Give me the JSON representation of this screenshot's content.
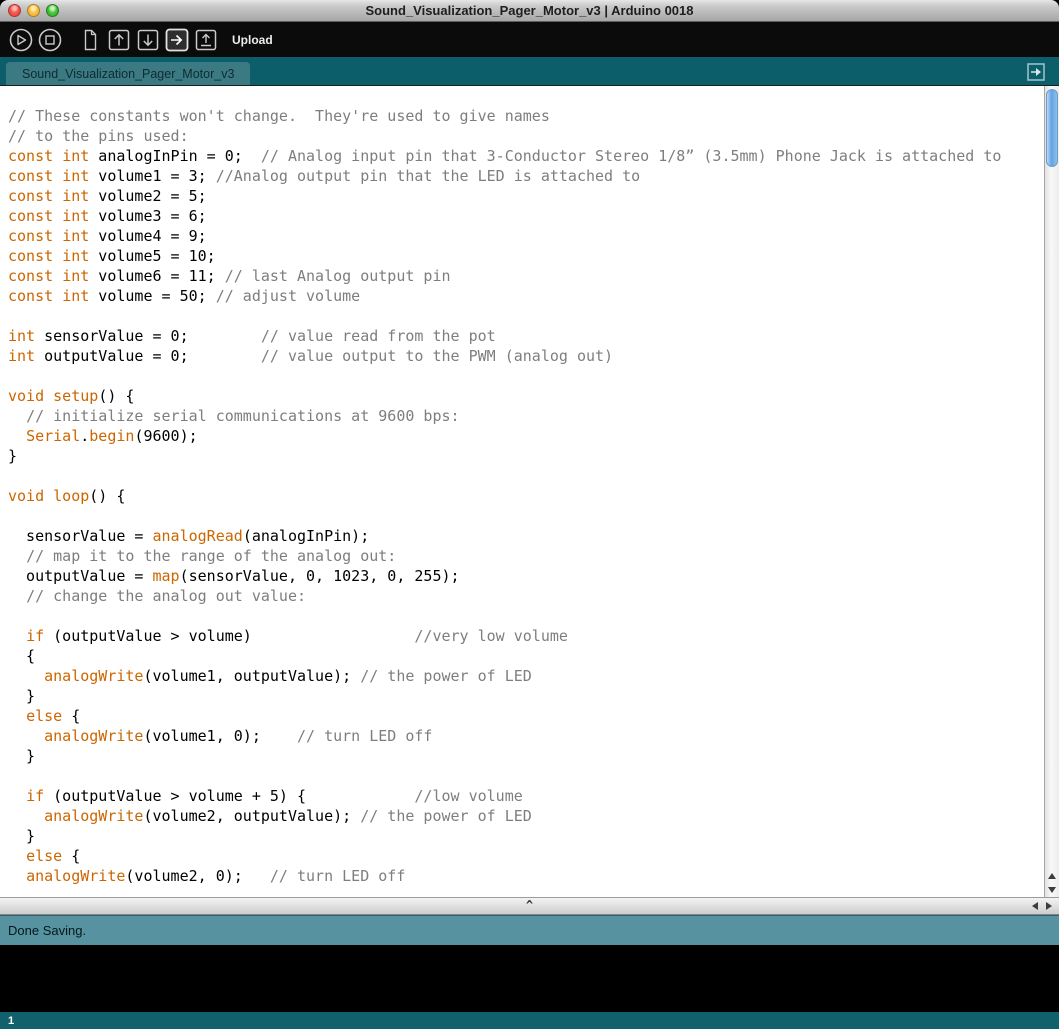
{
  "window": {
    "title": "Sound_Visualization_Pager_Motor_v3 | Arduino 0018"
  },
  "toolbar": {
    "action_label": "Upload",
    "buttons": [
      {
        "name": "verify",
        "icon": "play-circle-icon"
      },
      {
        "name": "stop",
        "icon": "stop-circle-icon"
      },
      {
        "name": "new-sketch",
        "icon": "document-icon"
      },
      {
        "name": "open",
        "icon": "arrow-up-box-icon"
      },
      {
        "name": "save",
        "icon": "arrow-down-box-icon"
      },
      {
        "name": "upload",
        "icon": "arrow-right-box-icon",
        "active": true
      },
      {
        "name": "serial-monitor",
        "icon": "serial-monitor-icon"
      }
    ]
  },
  "tabs": [
    {
      "label": "Sound_Visualization_Pager_Motor_v3",
      "active": true
    }
  ],
  "splitter": {
    "glyph": "^"
  },
  "status": {
    "message": "Done Saving.",
    "line_number": "1"
  },
  "colors": {
    "accent_keyword": "#CC6600",
    "comment_gray": "#7E7E7E",
    "code_text": "#000000",
    "toolbar_bg": "#0b0b0b",
    "icon_stroke": "#c9c9c9",
    "tabbar_bg": "#0c5f6a",
    "tab_active_bg": "#3c7a83",
    "tab_text": "#0d2b30",
    "statusbar_bg": "#5692a0",
    "statusbar_text": "#06181c",
    "console_bg": "#000000",
    "linebar_bg": "#11616c",
    "linebar_text": "#ffffff",
    "titlebar_text": "#1e1e1e"
  },
  "code": {
    "lines": [
      [
        [
          "c",
          "// These constants won't change.  They're used to give names"
        ]
      ],
      [
        [
          "c",
          "// to the pins used:"
        ]
      ],
      [
        [
          "k",
          "const"
        ],
        [
          "p",
          " "
        ],
        [
          "k",
          "int"
        ],
        [
          "p",
          " analogInPin = 0;  "
        ],
        [
          "c",
          "// Analog input pin that 3-Conductor Stereo 1/8” (3.5mm) Phone Jack is attached to"
        ]
      ],
      [
        [
          "k",
          "const"
        ],
        [
          "p",
          " "
        ],
        [
          "k",
          "int"
        ],
        [
          "p",
          " volume1 = 3; "
        ],
        [
          "c",
          "//Analog output pin that the LED is attached to"
        ]
      ],
      [
        [
          "k",
          "const"
        ],
        [
          "p",
          " "
        ],
        [
          "k",
          "int"
        ],
        [
          "p",
          " volume2 = 5;"
        ]
      ],
      [
        [
          "k",
          "const"
        ],
        [
          "p",
          " "
        ],
        [
          "k",
          "int"
        ],
        [
          "p",
          " volume3 = 6;"
        ]
      ],
      [
        [
          "k",
          "const"
        ],
        [
          "p",
          " "
        ],
        [
          "k",
          "int"
        ],
        [
          "p",
          " volume4 = 9;"
        ]
      ],
      [
        [
          "k",
          "const"
        ],
        [
          "p",
          " "
        ],
        [
          "k",
          "int"
        ],
        [
          "p",
          " volume5 = 10;"
        ]
      ],
      [
        [
          "k",
          "const"
        ],
        [
          "p",
          " "
        ],
        [
          "k",
          "int"
        ],
        [
          "p",
          " volume6 = 11; "
        ],
        [
          "c",
          "// last Analog output pin"
        ]
      ],
      [
        [
          "k",
          "const"
        ],
        [
          "p",
          " "
        ],
        [
          "k",
          "int"
        ],
        [
          "p",
          " volume = 50; "
        ],
        [
          "c",
          "// adjust volume"
        ]
      ],
      [],
      [
        [
          "k",
          "int"
        ],
        [
          "p",
          " sensorValue = 0;        "
        ],
        [
          "c",
          "// value read from the pot"
        ]
      ],
      [
        [
          "k",
          "int"
        ],
        [
          "p",
          " outputValue = 0;        "
        ],
        [
          "c",
          "// value output to the PWM (analog out)"
        ]
      ],
      [],
      [
        [
          "k",
          "void"
        ],
        [
          "p",
          " "
        ],
        [
          "k",
          "setup"
        ],
        [
          "p",
          "() {"
        ]
      ],
      [
        [
          "p",
          "  "
        ],
        [
          "c",
          "// initialize serial communications at 9600 bps:"
        ]
      ],
      [
        [
          "p",
          "  "
        ],
        [
          "k",
          "Serial"
        ],
        [
          "p",
          "."
        ],
        [
          "k",
          "begin"
        ],
        [
          "p",
          "(9600);"
        ]
      ],
      [
        [
          "p",
          "}"
        ]
      ],
      [],
      [
        [
          "k",
          "void"
        ],
        [
          "p",
          " "
        ],
        [
          "k",
          "loop"
        ],
        [
          "p",
          "() {"
        ]
      ],
      [],
      [
        [
          "p",
          "  sensorValue = "
        ],
        [
          "k",
          "analogRead"
        ],
        [
          "p",
          "(analogInPin);"
        ]
      ],
      [
        [
          "p",
          "  "
        ],
        [
          "c",
          "// map it to the range of the analog out:"
        ]
      ],
      [
        [
          "p",
          "  outputValue = "
        ],
        [
          "k",
          "map"
        ],
        [
          "p",
          "(sensorValue, 0, 1023, 0, 255);"
        ]
      ],
      [
        [
          "p",
          "  "
        ],
        [
          "c",
          "// change the analog out value:"
        ]
      ],
      [],
      [
        [
          "p",
          "  "
        ],
        [
          "k",
          "if"
        ],
        [
          "p",
          " (outputValue > volume)                  "
        ],
        [
          "c",
          "//very low volume"
        ]
      ],
      [
        [
          "p",
          "  {"
        ]
      ],
      [
        [
          "p",
          "    "
        ],
        [
          "k",
          "analogWrite"
        ],
        [
          "p",
          "(volume1, outputValue); "
        ],
        [
          "c",
          "// the power of LED"
        ]
      ],
      [
        [
          "p",
          "  }"
        ]
      ],
      [
        [
          "p",
          "  "
        ],
        [
          "k",
          "else"
        ],
        [
          "p",
          " {"
        ]
      ],
      [
        [
          "p",
          "    "
        ],
        [
          "k",
          "analogWrite"
        ],
        [
          "p",
          "(volume1, 0);    "
        ],
        [
          "c",
          "// turn LED off"
        ]
      ],
      [
        [
          "p",
          "  }"
        ]
      ],
      [],
      [
        [
          "p",
          "  "
        ],
        [
          "k",
          "if"
        ],
        [
          "p",
          " (outputValue > volume + 5) {            "
        ],
        [
          "c",
          "//low volume"
        ]
      ],
      [
        [
          "p",
          "    "
        ],
        [
          "k",
          "analogWrite"
        ],
        [
          "p",
          "(volume2, outputValue); "
        ],
        [
          "c",
          "// the power of LED"
        ]
      ],
      [
        [
          "p",
          "  }"
        ]
      ],
      [
        [
          "p",
          "  "
        ],
        [
          "k",
          "else"
        ],
        [
          "p",
          " {"
        ]
      ],
      [
        [
          "p",
          "  "
        ],
        [
          "k",
          "analogWrite"
        ],
        [
          "p",
          "(volume2, 0);   "
        ],
        [
          "c",
          "// turn LED off"
        ]
      ]
    ]
  }
}
